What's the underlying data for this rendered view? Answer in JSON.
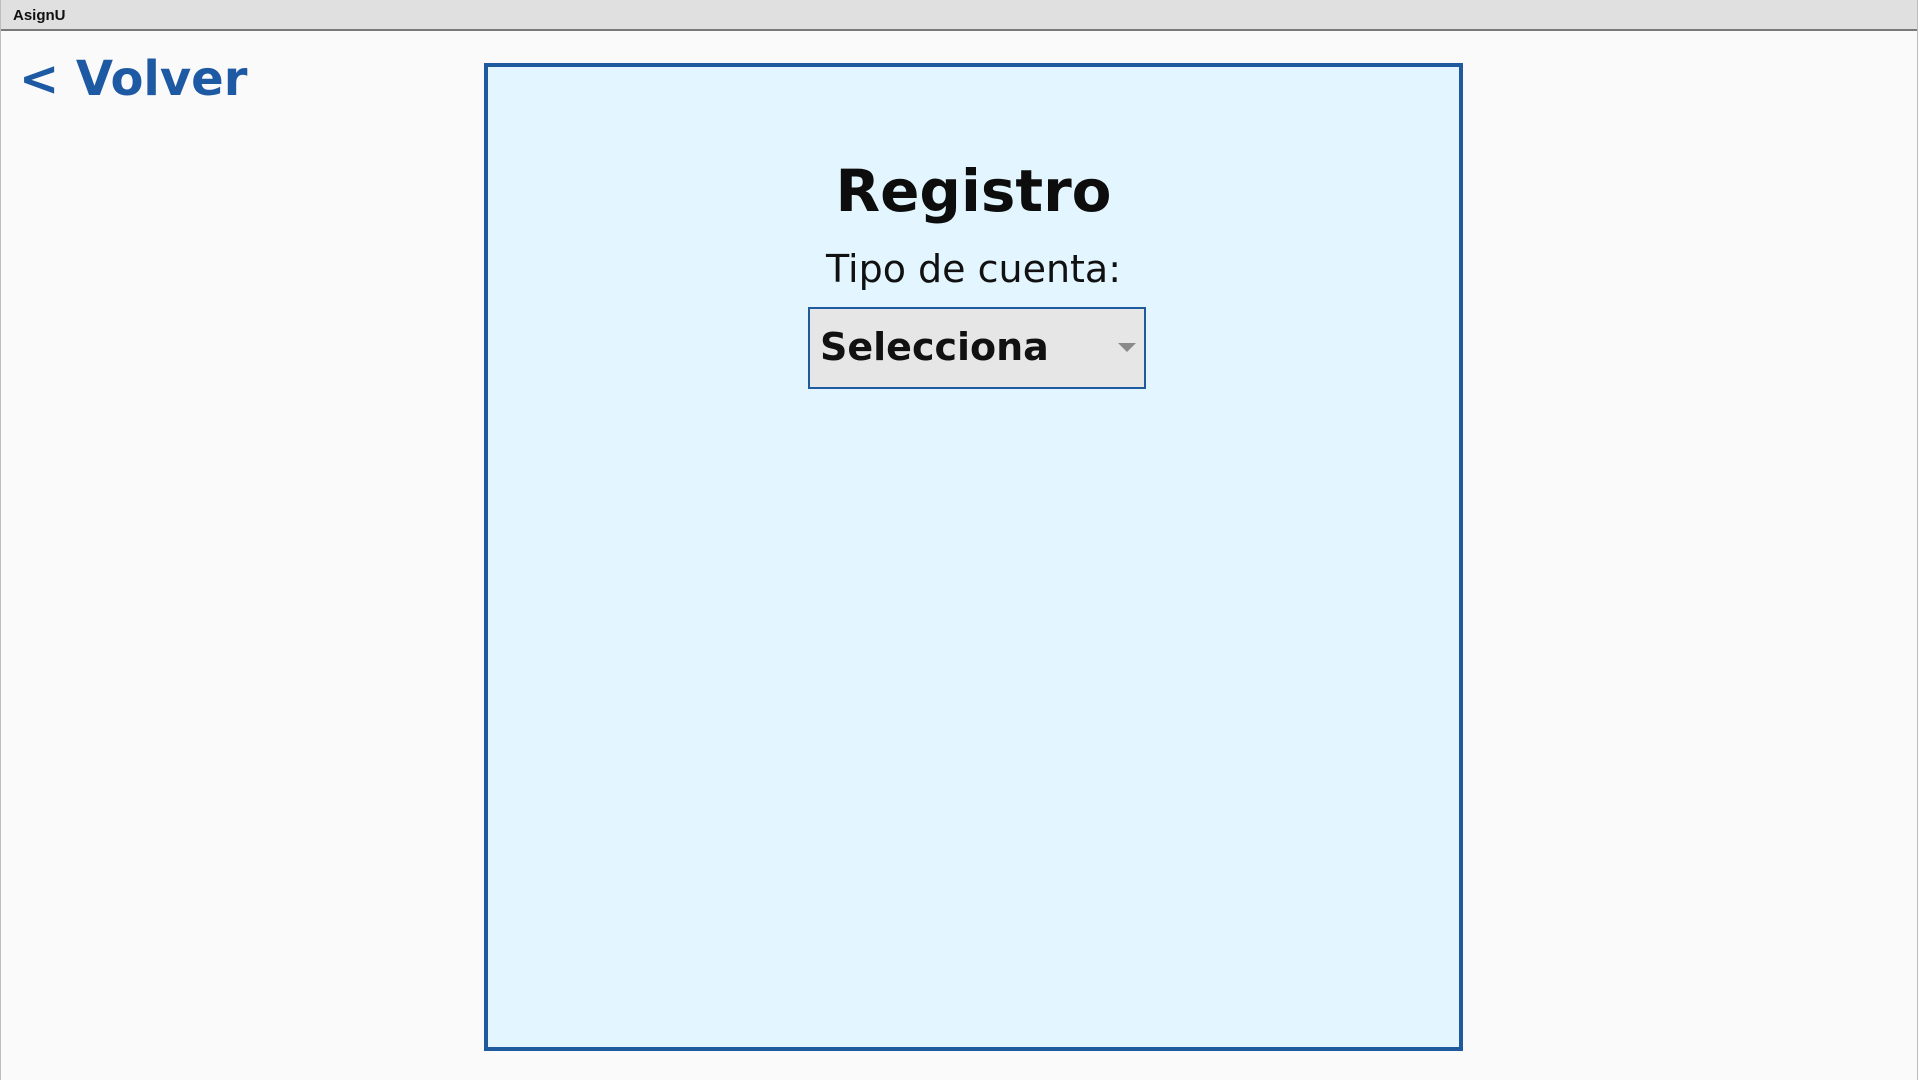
{
  "window": {
    "title": "AsignU"
  },
  "nav": {
    "back_label": "< Volver"
  },
  "registration": {
    "title": "Registro",
    "account_type_label": "Tipo de cuenta:",
    "account_type_select": {
      "selected": "Selecciona",
      "icon": "chevron-down-icon"
    }
  },
  "colors": {
    "accent": "#1f5a9f",
    "panel_background": "#e3f6ff",
    "page_background": "#fafafa",
    "titlebar_background": "#e0e0e0"
  }
}
